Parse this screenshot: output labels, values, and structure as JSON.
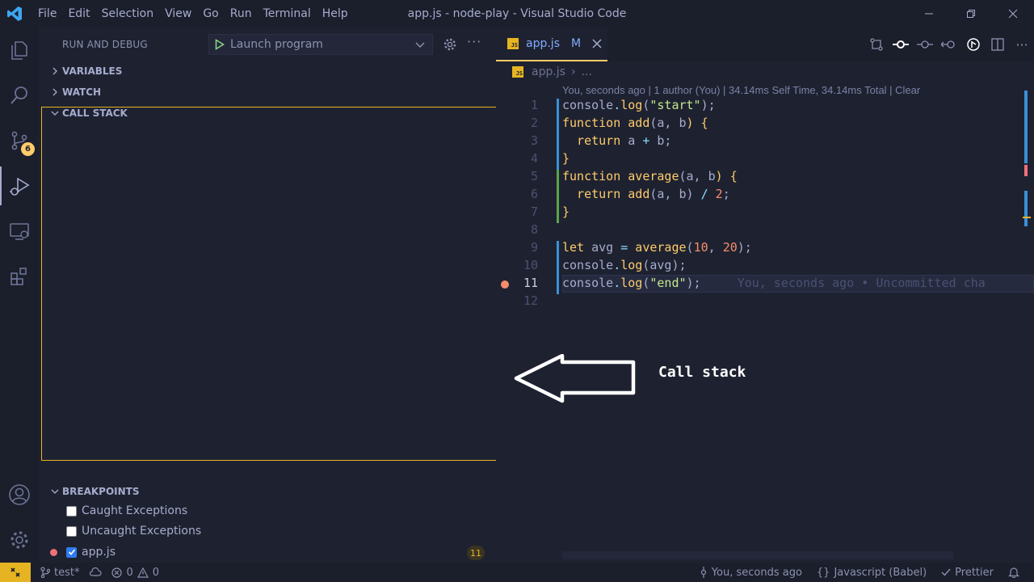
{
  "window": {
    "title": "app.js - node-play - Visual Studio Code",
    "menu": [
      "File",
      "Edit",
      "Selection",
      "View",
      "Go",
      "Run",
      "Terminal",
      "Help"
    ]
  },
  "activity": {
    "scm_badge": "6"
  },
  "sidebar": {
    "title": "RUN AND DEBUG",
    "launch_config": "Launch program",
    "sections": {
      "variables": "VARIABLES",
      "watch": "WATCH",
      "call_stack": "CALL STACK",
      "breakpoints": "BREAKPOINTS"
    },
    "breakpoints": [
      {
        "label": "Caught Exceptions",
        "checked": false
      },
      {
        "label": "Uncaught Exceptions",
        "checked": false
      },
      {
        "label": "app.js",
        "checked": true,
        "count": "11"
      }
    ]
  },
  "editor": {
    "tab": {
      "name": "app.js",
      "status": "M",
      "icon": "JS"
    },
    "breadcrumb": [
      "app.js",
      "..."
    ],
    "codelens": "You, seconds ago | 1 author (You) | 34.14ms Self Time, 34.14ms Total | Clear",
    "lines": [
      {
        "n": "1"
      },
      {
        "n": "2"
      },
      {
        "n": "3"
      },
      {
        "n": "4"
      },
      {
        "n": "5"
      },
      {
        "n": "6"
      },
      {
        "n": "7"
      },
      {
        "n": "8"
      },
      {
        "n": "9"
      },
      {
        "n": "10"
      },
      {
        "n": "11"
      },
      {
        "n": "12"
      }
    ],
    "code": {
      "l1": [
        "console",
        ".",
        "log",
        "(",
        "\"start\"",
        ");"
      ],
      "l2": [
        "function",
        " add",
        "(",
        "a, b",
        ") {"
      ],
      "l3": [
        "  return",
        " a ",
        "+",
        " b;"
      ],
      "l4": [
        "}"
      ],
      "l5": [
        "function",
        " average",
        "(",
        "a, b",
        ") {"
      ],
      "l6": [
        "  return",
        " add",
        "(",
        "a, b",
        ") ",
        "/",
        " ",
        "2",
        ";"
      ],
      "l7": [
        "}"
      ],
      "l9": [
        "let",
        " avg ",
        "=",
        " average",
        "(",
        "10",
        ", ",
        "20",
        ");"
      ],
      "l10": [
        "console",
        ".",
        "log",
        "(avg);"
      ],
      "l11": [
        "console",
        ".",
        "log",
        "(",
        "\"end\"",
        ");"
      ]
    },
    "blame": "You, seconds ago • Uncommitted cha"
  },
  "annotation": {
    "label": "Call stack"
  },
  "statusbar": {
    "branch": "test*",
    "errors": "0",
    "warnings": "0",
    "blame": "You, seconds ago",
    "language": "Javascript (Babel)",
    "formatter": "Prettier"
  },
  "colors": {
    "accent": "#e6b422",
    "background": "#1e2230",
    "chrome": "#1b1e2b"
  }
}
